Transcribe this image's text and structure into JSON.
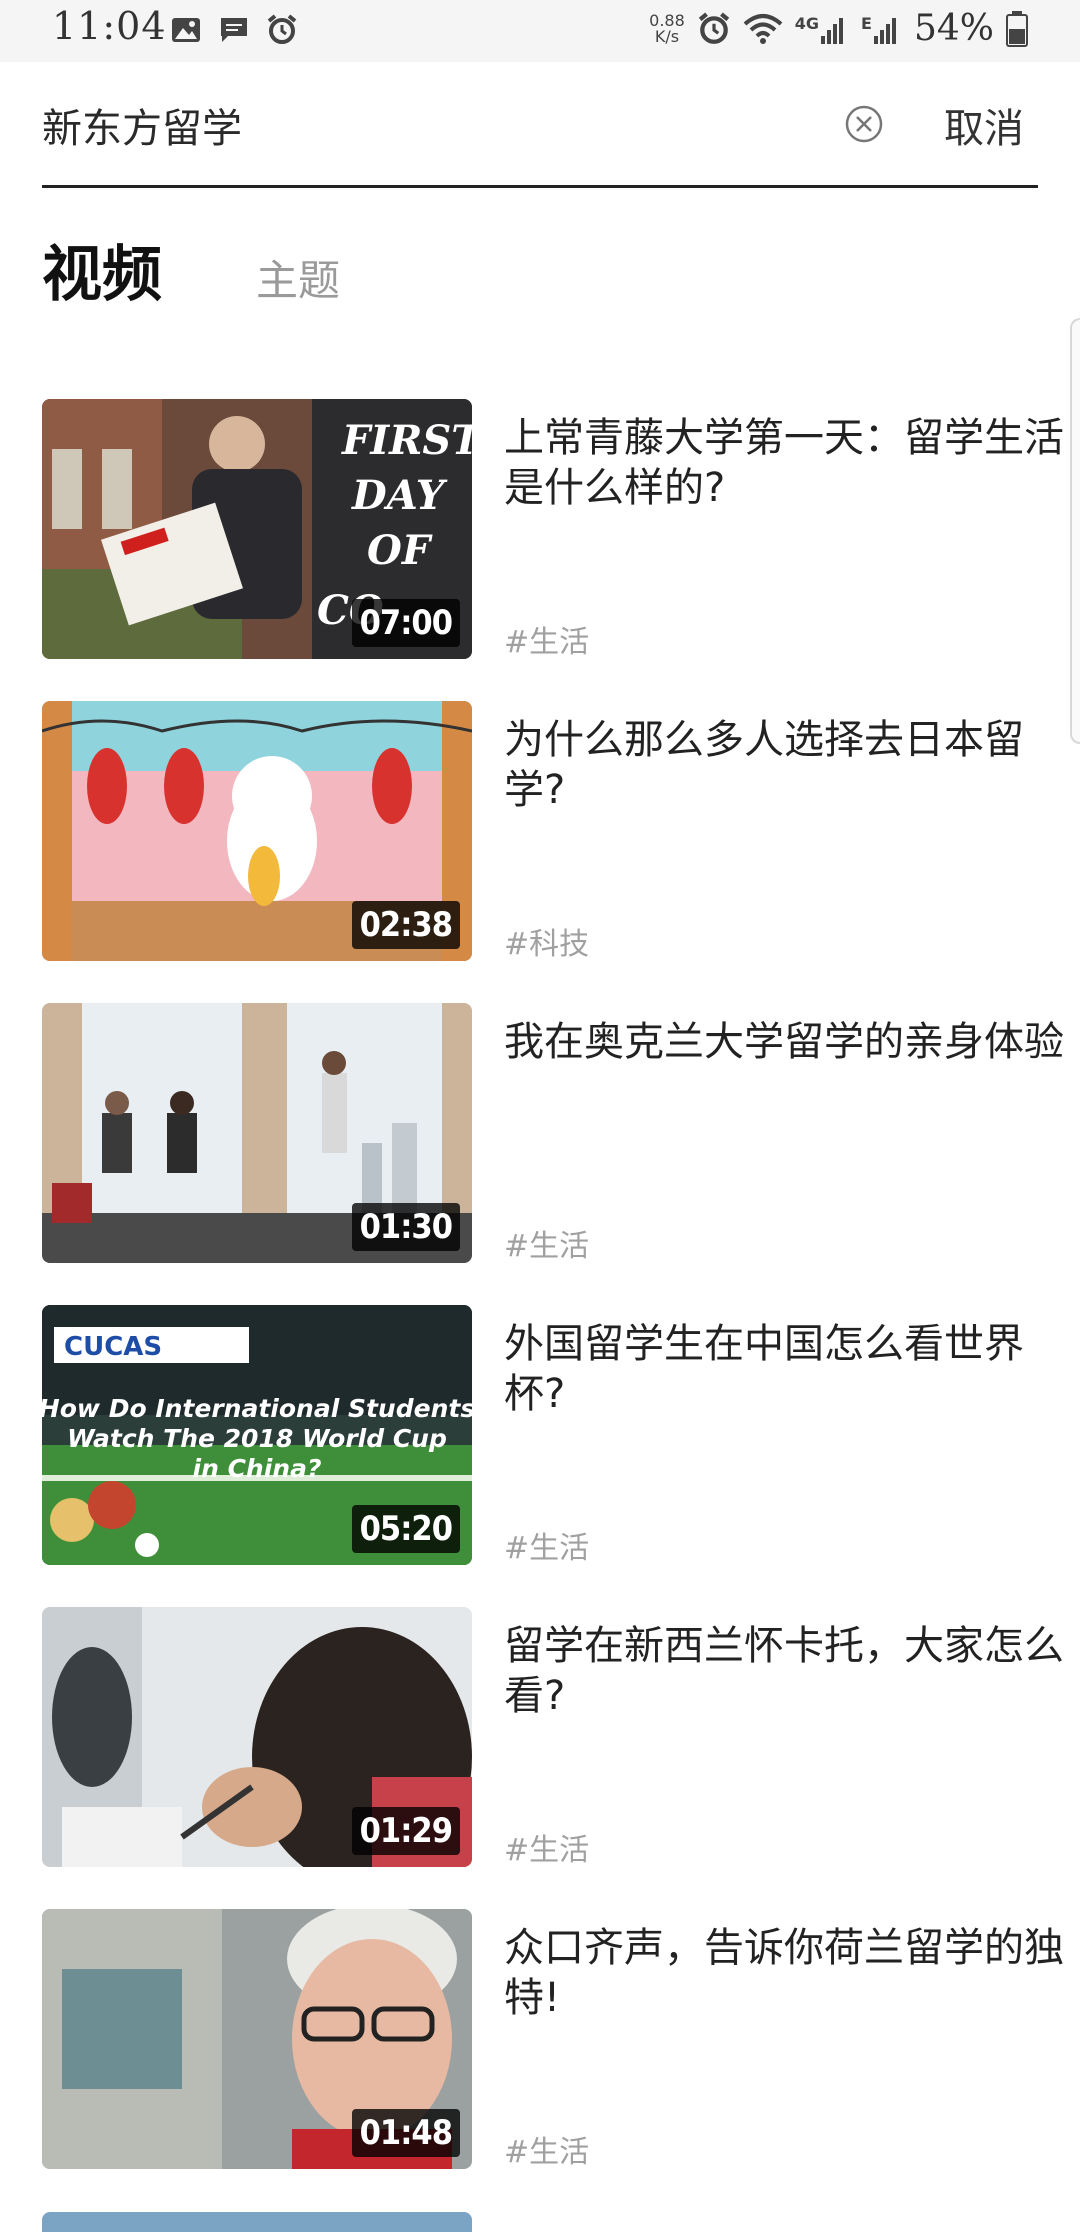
{
  "status_bar": {
    "time": "11:04",
    "net_speed_value": "0.88",
    "net_speed_unit": "K/s",
    "network_label": "4G",
    "network_label2": "E",
    "battery": "54%",
    "left_icons": [
      "image-icon",
      "message-icon",
      "alarm-icon"
    ],
    "right_icons": [
      "alarm-icon",
      "wifi-icon",
      "signal-icon",
      "signal-icon",
      "battery-icon"
    ]
  },
  "search": {
    "query": "新东方留学",
    "clear_icon": "clear-circle-icon",
    "cancel_label": "取消"
  },
  "tabs": [
    {
      "label": "视频",
      "active": true
    },
    {
      "label": "主题",
      "active": false
    }
  ],
  "videos": [
    {
      "title": "上常青藤大学第一天：留学生活是什么样的?",
      "duration": "07:00",
      "tag": "#生活",
      "thumb_text": "FIRST DAY OF CO"
    },
    {
      "title": "为什么那么多人选择去日本留学?",
      "duration": "02:38",
      "tag": "#科技",
      "thumb_text": ""
    },
    {
      "title": "我在奥克兰大学留学的亲身体验",
      "duration": "01:30",
      "tag": "#生活",
      "thumb_text": ""
    },
    {
      "title": "外国留学生在中国怎么看世界杯?",
      "duration": "05:20",
      "tag": "#生活",
      "thumb_text": "How Do International Students Watch The 2018 World Cup in China?"
    },
    {
      "title": "留学在新西兰怀卡托，大家怎么看?",
      "duration": "01:29",
      "tag": "#生活",
      "thumb_text": ""
    },
    {
      "title": "众口齐声，告诉你荷兰留学的独特!",
      "duration": "01:48",
      "tag": "#生活",
      "thumb_text": ""
    }
  ],
  "colors": {
    "title": "#222222",
    "tag": "#a0a0a0",
    "tab_inactive": "#9a9a9a",
    "divider": "#222222"
  }
}
